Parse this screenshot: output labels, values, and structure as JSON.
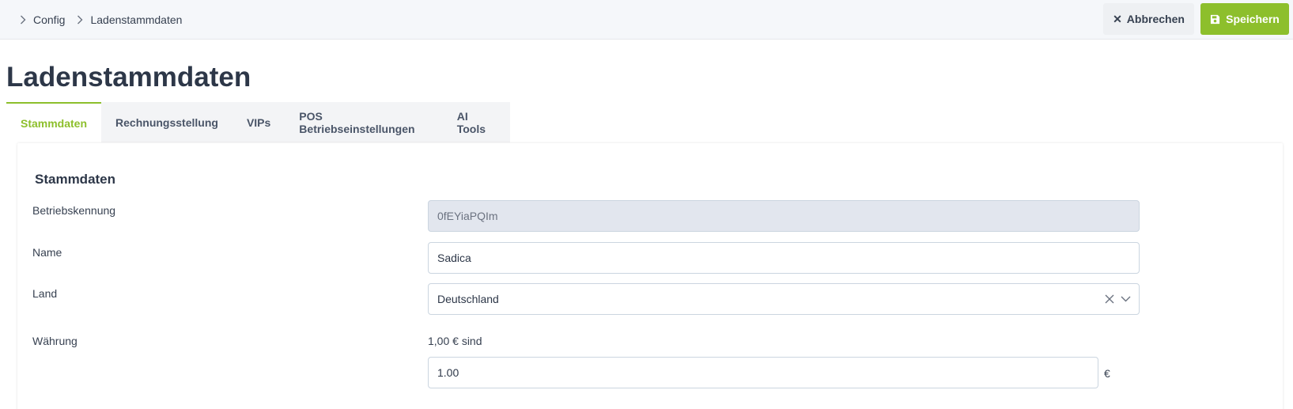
{
  "breadcrumb": [
    "Config",
    "Ladenstammdaten"
  ],
  "actions": {
    "cancel_label": "Abbrechen",
    "save_label": "Speichern"
  },
  "page_title": "Ladenstammdaten",
  "tabs": [
    "Stammdaten",
    "Rechnungsstellung",
    "VIPs",
    "POS Betriebseinstellungen",
    "AI Tools"
  ],
  "active_tab": "Stammdaten",
  "card": {
    "title": "Stammdaten",
    "fields": {
      "betriebskennung": {
        "label": "Betriebskennung",
        "value": "0fEYiaPQIm"
      },
      "name": {
        "label": "Name",
        "value": "Sadica"
      },
      "land": {
        "label": "Land",
        "value": "Deutschland"
      },
      "waehrung": {
        "label": "Währung",
        "rate_text": "1,00 € sind",
        "value": "1.00",
        "unit": "€"
      }
    }
  },
  "colors": {
    "accent": "#8dbf2c",
    "topbar": "#f5f7fa",
    "readonly_bg": "#e2e6ee"
  },
  "icons": [
    "chevron-right-icon",
    "close-icon",
    "save-icon",
    "clear-icon",
    "chevron-down-icon"
  ]
}
